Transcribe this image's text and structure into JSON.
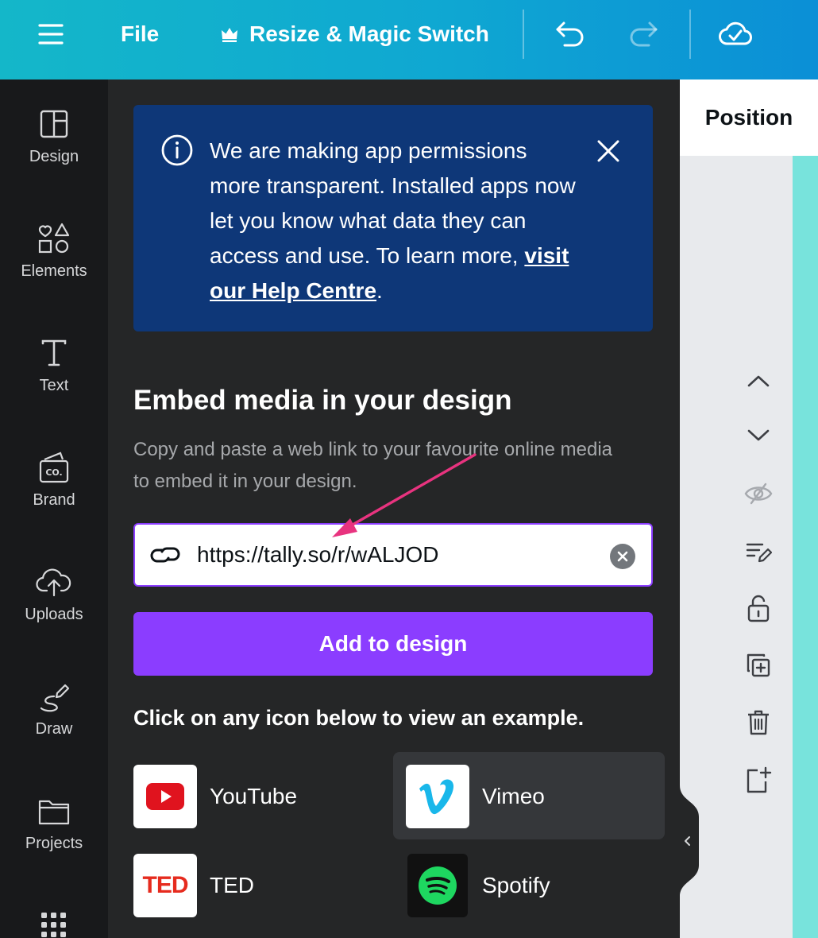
{
  "topbar": {
    "file_label": "File",
    "resize_label": "Resize & Magic Switch"
  },
  "leftnav": {
    "items": [
      {
        "label": "Design"
      },
      {
        "label": "Elements"
      },
      {
        "label": "Text"
      },
      {
        "label": "Brand"
      },
      {
        "label": "Uploads"
      },
      {
        "label": "Draw"
      },
      {
        "label": "Projects"
      }
    ]
  },
  "notice": {
    "text": "We are making app permissions more transparent. Installed apps now let you know what data they can access and use. To learn more, ",
    "link_text": "visit our Help Centre",
    "suffix": "."
  },
  "embed": {
    "heading": "Embed media in your design",
    "description": "Copy and paste a web link to your favourite online media to embed it in your design.",
    "url_value": "https://tally.so/r/wALJOD",
    "add_button": "Add to design",
    "examples_heading": "Click on any icon below to view an example.",
    "examples": [
      {
        "label": "YouTube"
      },
      {
        "label": "Vimeo"
      },
      {
        "label": "TED",
        "logo_text": "TED"
      },
      {
        "label": "Spotify"
      }
    ]
  },
  "rightpanel": {
    "tab_label": "Position"
  },
  "colors": {
    "accent": "#8b3dff",
    "notice_bg": "#0e3778",
    "annotation_arrow": "#e8337f"
  }
}
